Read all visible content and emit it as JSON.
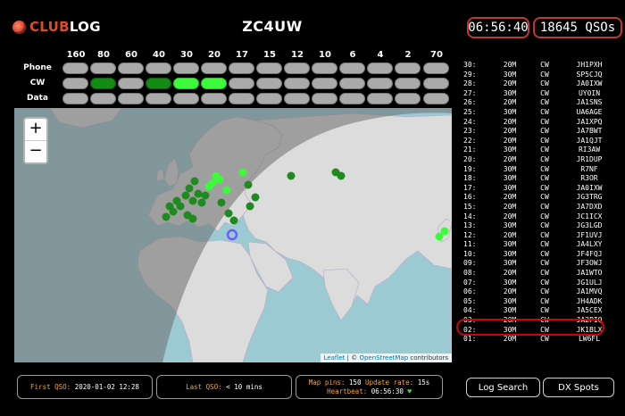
{
  "header": {
    "logo_club": "CLUB",
    "logo_log": "LOG",
    "callsign": "ZC4UW",
    "clock": "06:56:40",
    "qso_count": "18645 QSOs"
  },
  "bands": [
    "160",
    "80",
    "60",
    "40",
    "30",
    "20",
    "17",
    "15",
    "12",
    "10",
    "6",
    "4",
    "2",
    "70"
  ],
  "modes": [
    {
      "label": "Phone",
      "states": [
        "off",
        "off",
        "off",
        "off",
        "off",
        "off",
        "off",
        "off",
        "off",
        "off",
        "off",
        "off",
        "off",
        "off"
      ]
    },
    {
      "label": "CW",
      "states": [
        "off",
        "mid",
        "off",
        "mid",
        "bright",
        "bright",
        "off",
        "off",
        "off",
        "off",
        "off",
        "off",
        "off",
        "off"
      ]
    },
    {
      "label": "Data",
      "states": [
        "off",
        "off",
        "off",
        "off",
        "off",
        "off",
        "off",
        "off",
        "off",
        "off",
        "off",
        "off",
        "off",
        "off"
      ]
    }
  ],
  "map": {
    "zoom_in": "+",
    "zoom_out": "−",
    "attribution_leaflet": "Leaflet",
    "attribution_sep": " | © ",
    "attribution_osm": "OpenStreetMap",
    "attribution_tail": " contributors",
    "colors": {
      "sea": "#9ccad3",
      "land": "#dcdcdc",
      "night": "#8a8a8a",
      "spot_dark": "#1f8a1f",
      "spot_bright": "#3dfa3d",
      "home": "#6a5cff"
    }
  },
  "log": [
    {
      "n": "30:",
      "band": "20M",
      "mode": "CW",
      "call": "JH1PXH"
    },
    {
      "n": "29:",
      "band": "30M",
      "mode": "CW",
      "call": "SP5CJQ"
    },
    {
      "n": "28:",
      "band": "20M",
      "mode": "CW",
      "call": "JA0IXW"
    },
    {
      "n": "27:",
      "band": "30M",
      "mode": "CW",
      "call": "UY0IN"
    },
    {
      "n": "26:",
      "band": "20M",
      "mode": "CW",
      "call": "JA1SNS"
    },
    {
      "n": "25:",
      "band": "30M",
      "mode": "CW",
      "call": "UA6AGE"
    },
    {
      "n": "24:",
      "band": "20M",
      "mode": "CW",
      "call": "JA1XPQ"
    },
    {
      "n": "23:",
      "band": "20M",
      "mode": "CW",
      "call": "JA7BWT"
    },
    {
      "n": "22:",
      "band": "20M",
      "mode": "CW",
      "call": "JA1QJT"
    },
    {
      "n": "21:",
      "band": "30M",
      "mode": "CW",
      "call": "RI3AW"
    },
    {
      "n": "20:",
      "band": "20M",
      "mode": "CW",
      "call": "JR1DUP"
    },
    {
      "n": "19:",
      "band": "30M",
      "mode": "CW",
      "call": "R7NF"
    },
    {
      "n": "18:",
      "band": "30M",
      "mode": "CW",
      "call": "R3OR"
    },
    {
      "n": "17:",
      "band": "30M",
      "mode": "CW",
      "call": "JA0IXW"
    },
    {
      "n": "16:",
      "band": "20M",
      "mode": "CW",
      "call": "JG3TRG"
    },
    {
      "n": "15:",
      "band": "20M",
      "mode": "CW",
      "call": "JA7DXD"
    },
    {
      "n": "14:",
      "band": "20M",
      "mode": "CW",
      "call": "JC1ICX"
    },
    {
      "n": "13:",
      "band": "30M",
      "mode": "CW",
      "call": "JG3LGD"
    },
    {
      "n": "12:",
      "band": "20M",
      "mode": "CW",
      "call": "JF1UVJ"
    },
    {
      "n": "11:",
      "band": "30M",
      "mode": "CW",
      "call": "JA4LXY"
    },
    {
      "n": "10:",
      "band": "30M",
      "mode": "CW",
      "call": "JF4FQJ"
    },
    {
      "n": "09:",
      "band": "30M",
      "mode": "CW",
      "call": "JF3OWJ"
    },
    {
      "n": "08:",
      "band": "20M",
      "mode": "CW",
      "call": "JA1WTO"
    },
    {
      "n": "07:",
      "band": "30M",
      "mode": "CW",
      "call": "JG1ULJ"
    },
    {
      "n": "06:",
      "band": "20M",
      "mode": "CW",
      "call": "JA1MVQ"
    },
    {
      "n": "05:",
      "band": "30M",
      "mode": "CW",
      "call": "JH4ADK"
    },
    {
      "n": "04:",
      "band": "30M",
      "mode": "CW",
      "call": "JA5CEX"
    },
    {
      "n": "03:",
      "band": "20M",
      "mode": "CW",
      "call": "JA2PIQ"
    },
    {
      "n": "02:",
      "band": "30M",
      "mode": "CW",
      "call": "JK1BLX"
    },
    {
      "n": "01:",
      "band": "20M",
      "mode": "CW",
      "call": "LW6FL"
    }
  ],
  "footer": {
    "first_qso_label": "First QSO:",
    "first_qso_value": "2020-01-02 12:28",
    "last_qso_label": "Last QSO:",
    "last_qso_value": "< 10 mins",
    "pins_label": "Map pins:",
    "pins_value": "150",
    "rate_label": "Update rate:",
    "rate_value": "15s",
    "heartbeat_label": "Heartbeat:",
    "heartbeat_value": "06:56:30",
    "heart_icon": "♥",
    "log_search": "Log Search",
    "dx_spots": "DX Spots"
  }
}
